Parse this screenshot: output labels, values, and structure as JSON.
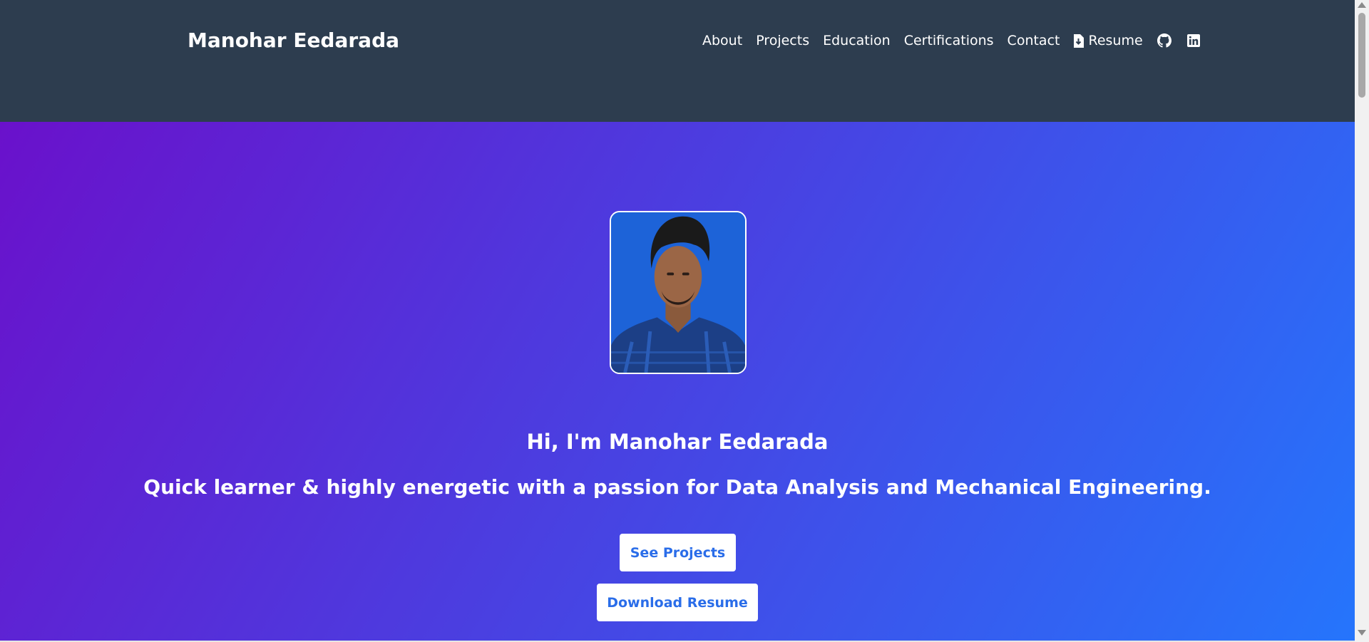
{
  "header": {
    "brand": "Manohar Eedarada",
    "nav": [
      {
        "label": "About"
      },
      {
        "label": "Projects"
      },
      {
        "label": "Education"
      },
      {
        "label": "Certifications"
      },
      {
        "label": "Contact"
      },
      {
        "label": "Resume",
        "icon": "file-download-icon"
      }
    ],
    "social": [
      {
        "icon": "github-icon"
      },
      {
        "icon": "linkedin-icon"
      }
    ]
  },
  "hero": {
    "photo": {
      "subject": "profile-photo"
    },
    "title": "Hi, I'm Manohar Eedarada",
    "subtitle": "Quick learner & highly energetic with a passion for Data Analysis and Mechanical Engineering.",
    "buttons": {
      "projects": "See Projects",
      "resume": "Download Resume"
    }
  },
  "colors": {
    "header_bg": "#2d3d4f",
    "gradient_start": "#6a11cb",
    "gradient_end": "#2575fc",
    "button_text": "#2a6de9",
    "button_bg": "#ffffff"
  }
}
